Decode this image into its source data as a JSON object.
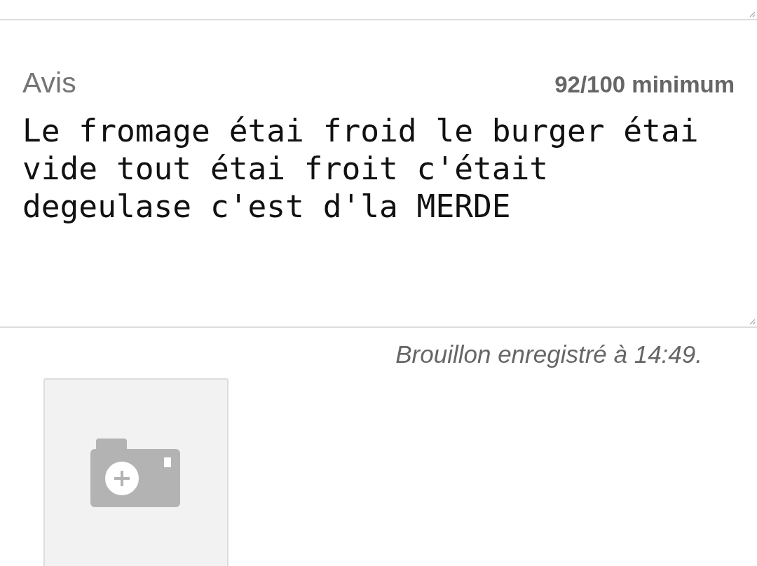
{
  "review": {
    "label": "Avis",
    "counter": "92/100 minimum",
    "value": "Le fromage étai froid le burger étai vide tout étai froit c'était degeulase c'est d'la MERDE"
  },
  "draft_status": "Brouillon enregistré à 14:49.",
  "photo_upload": {
    "kind": "add-photo"
  }
}
